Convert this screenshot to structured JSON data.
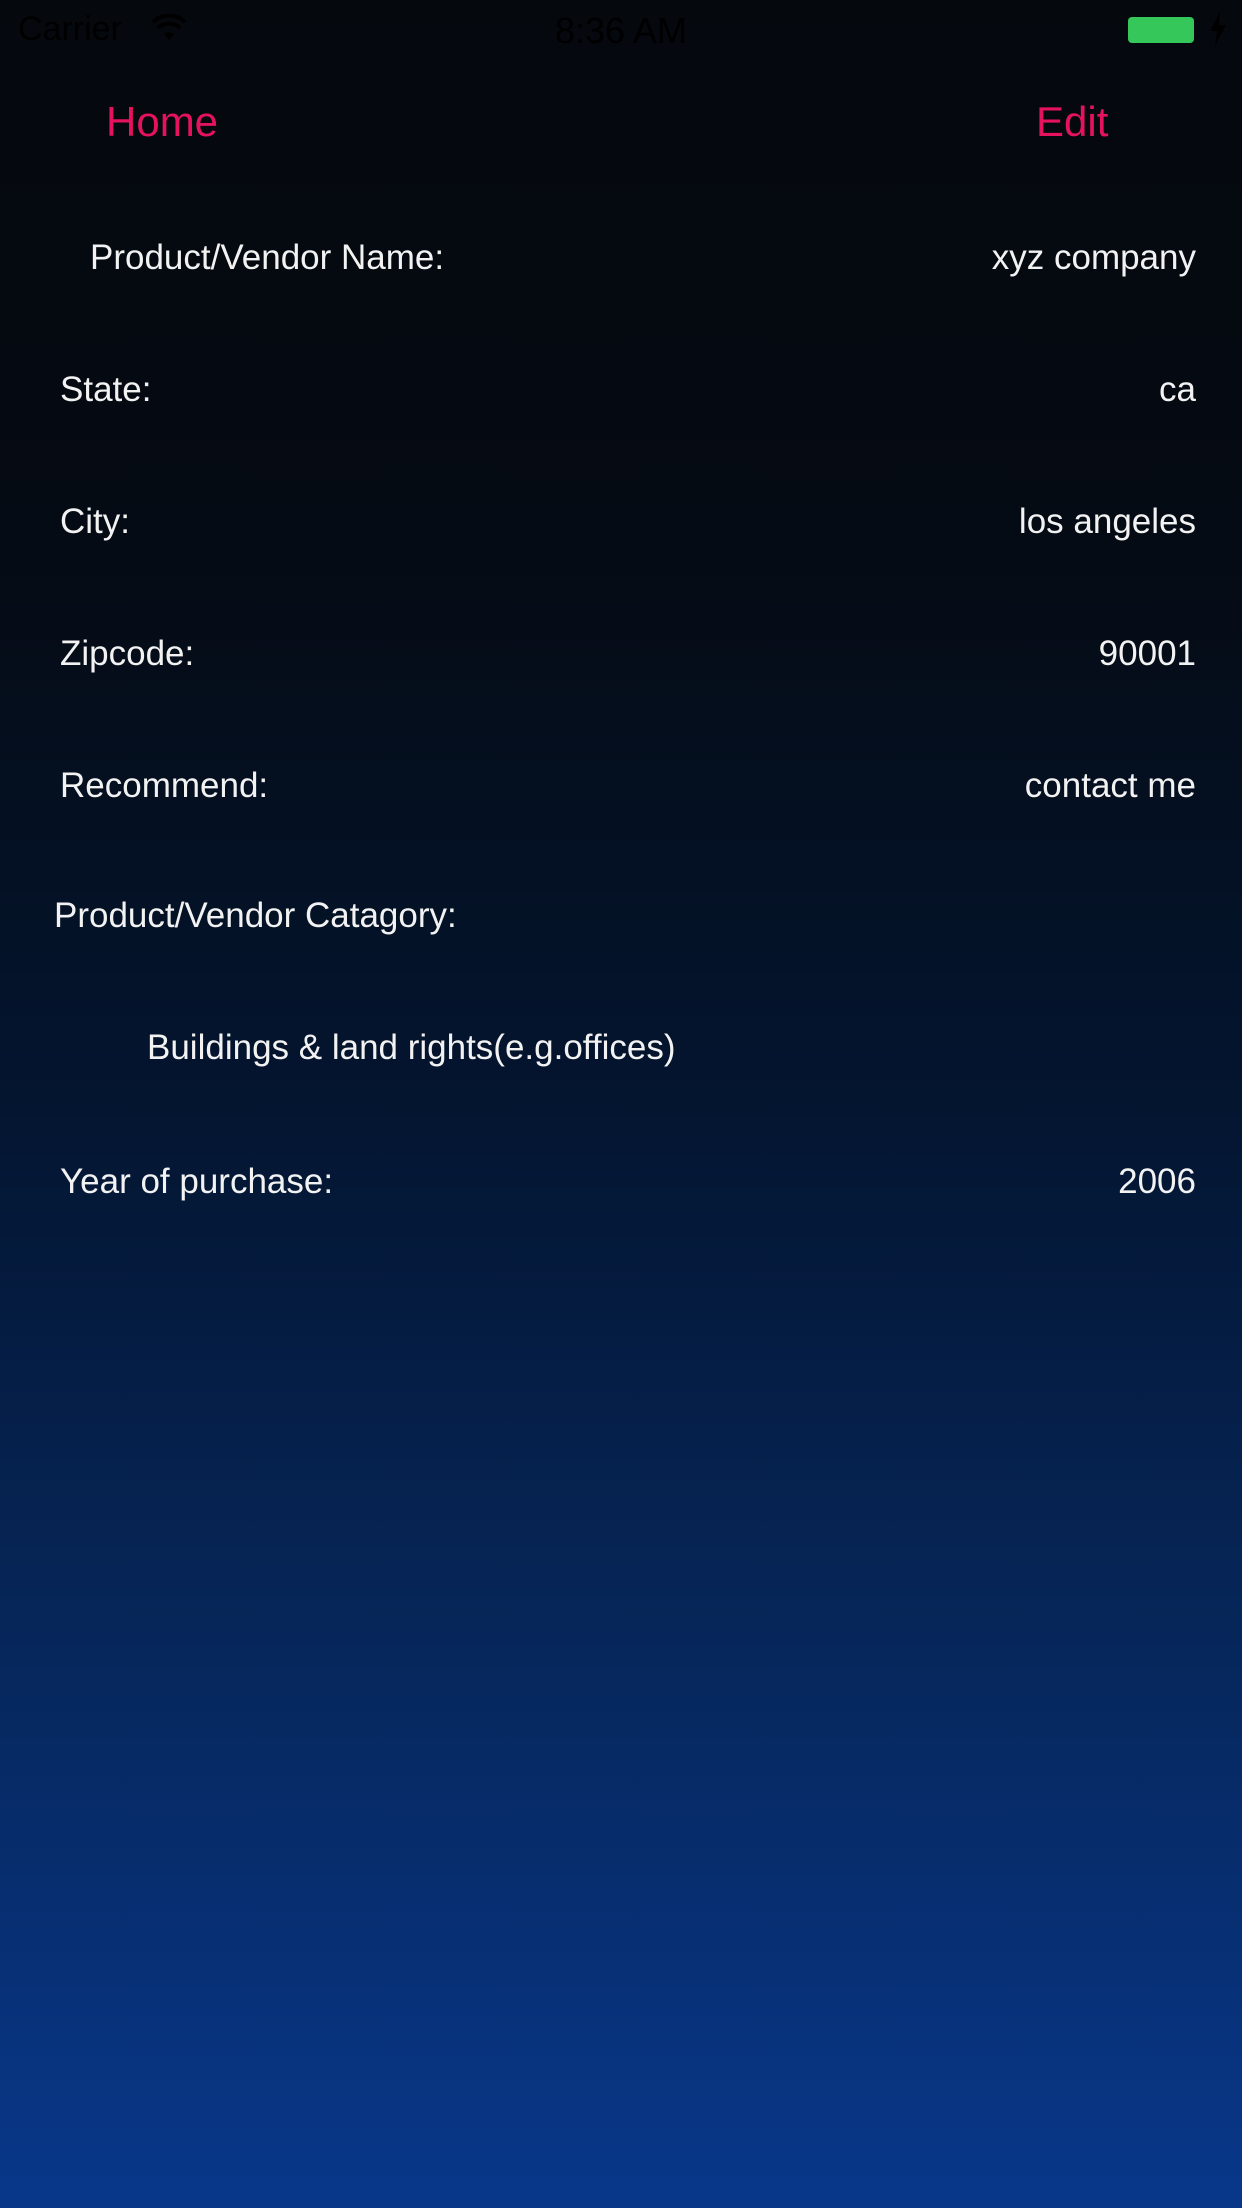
{
  "status_bar": {
    "carrier": "Carrier",
    "time": "8:36 AM",
    "battery_color": "#35c759"
  },
  "nav": {
    "home_label": "Home",
    "edit_label": "Edit",
    "accent_color": "#e5125e"
  },
  "details": {
    "vendor_name_label": "Product/Vendor Name:",
    "vendor_name_value": "xyz company",
    "state_label": "State:",
    "state_value": "ca",
    "city_label": "City:",
    "city_value": "los angeles",
    "zipcode_label": "Zipcode:",
    "zipcode_value": "90001",
    "recommend_label": "Recommend:",
    "recommend_value": "contact me",
    "category_label": "Product/Vendor Catagory:",
    "category_value": "Buildings & land rights(e.g.offices)",
    "year_label": "Year of purchase:",
    "year_value": "2006"
  }
}
